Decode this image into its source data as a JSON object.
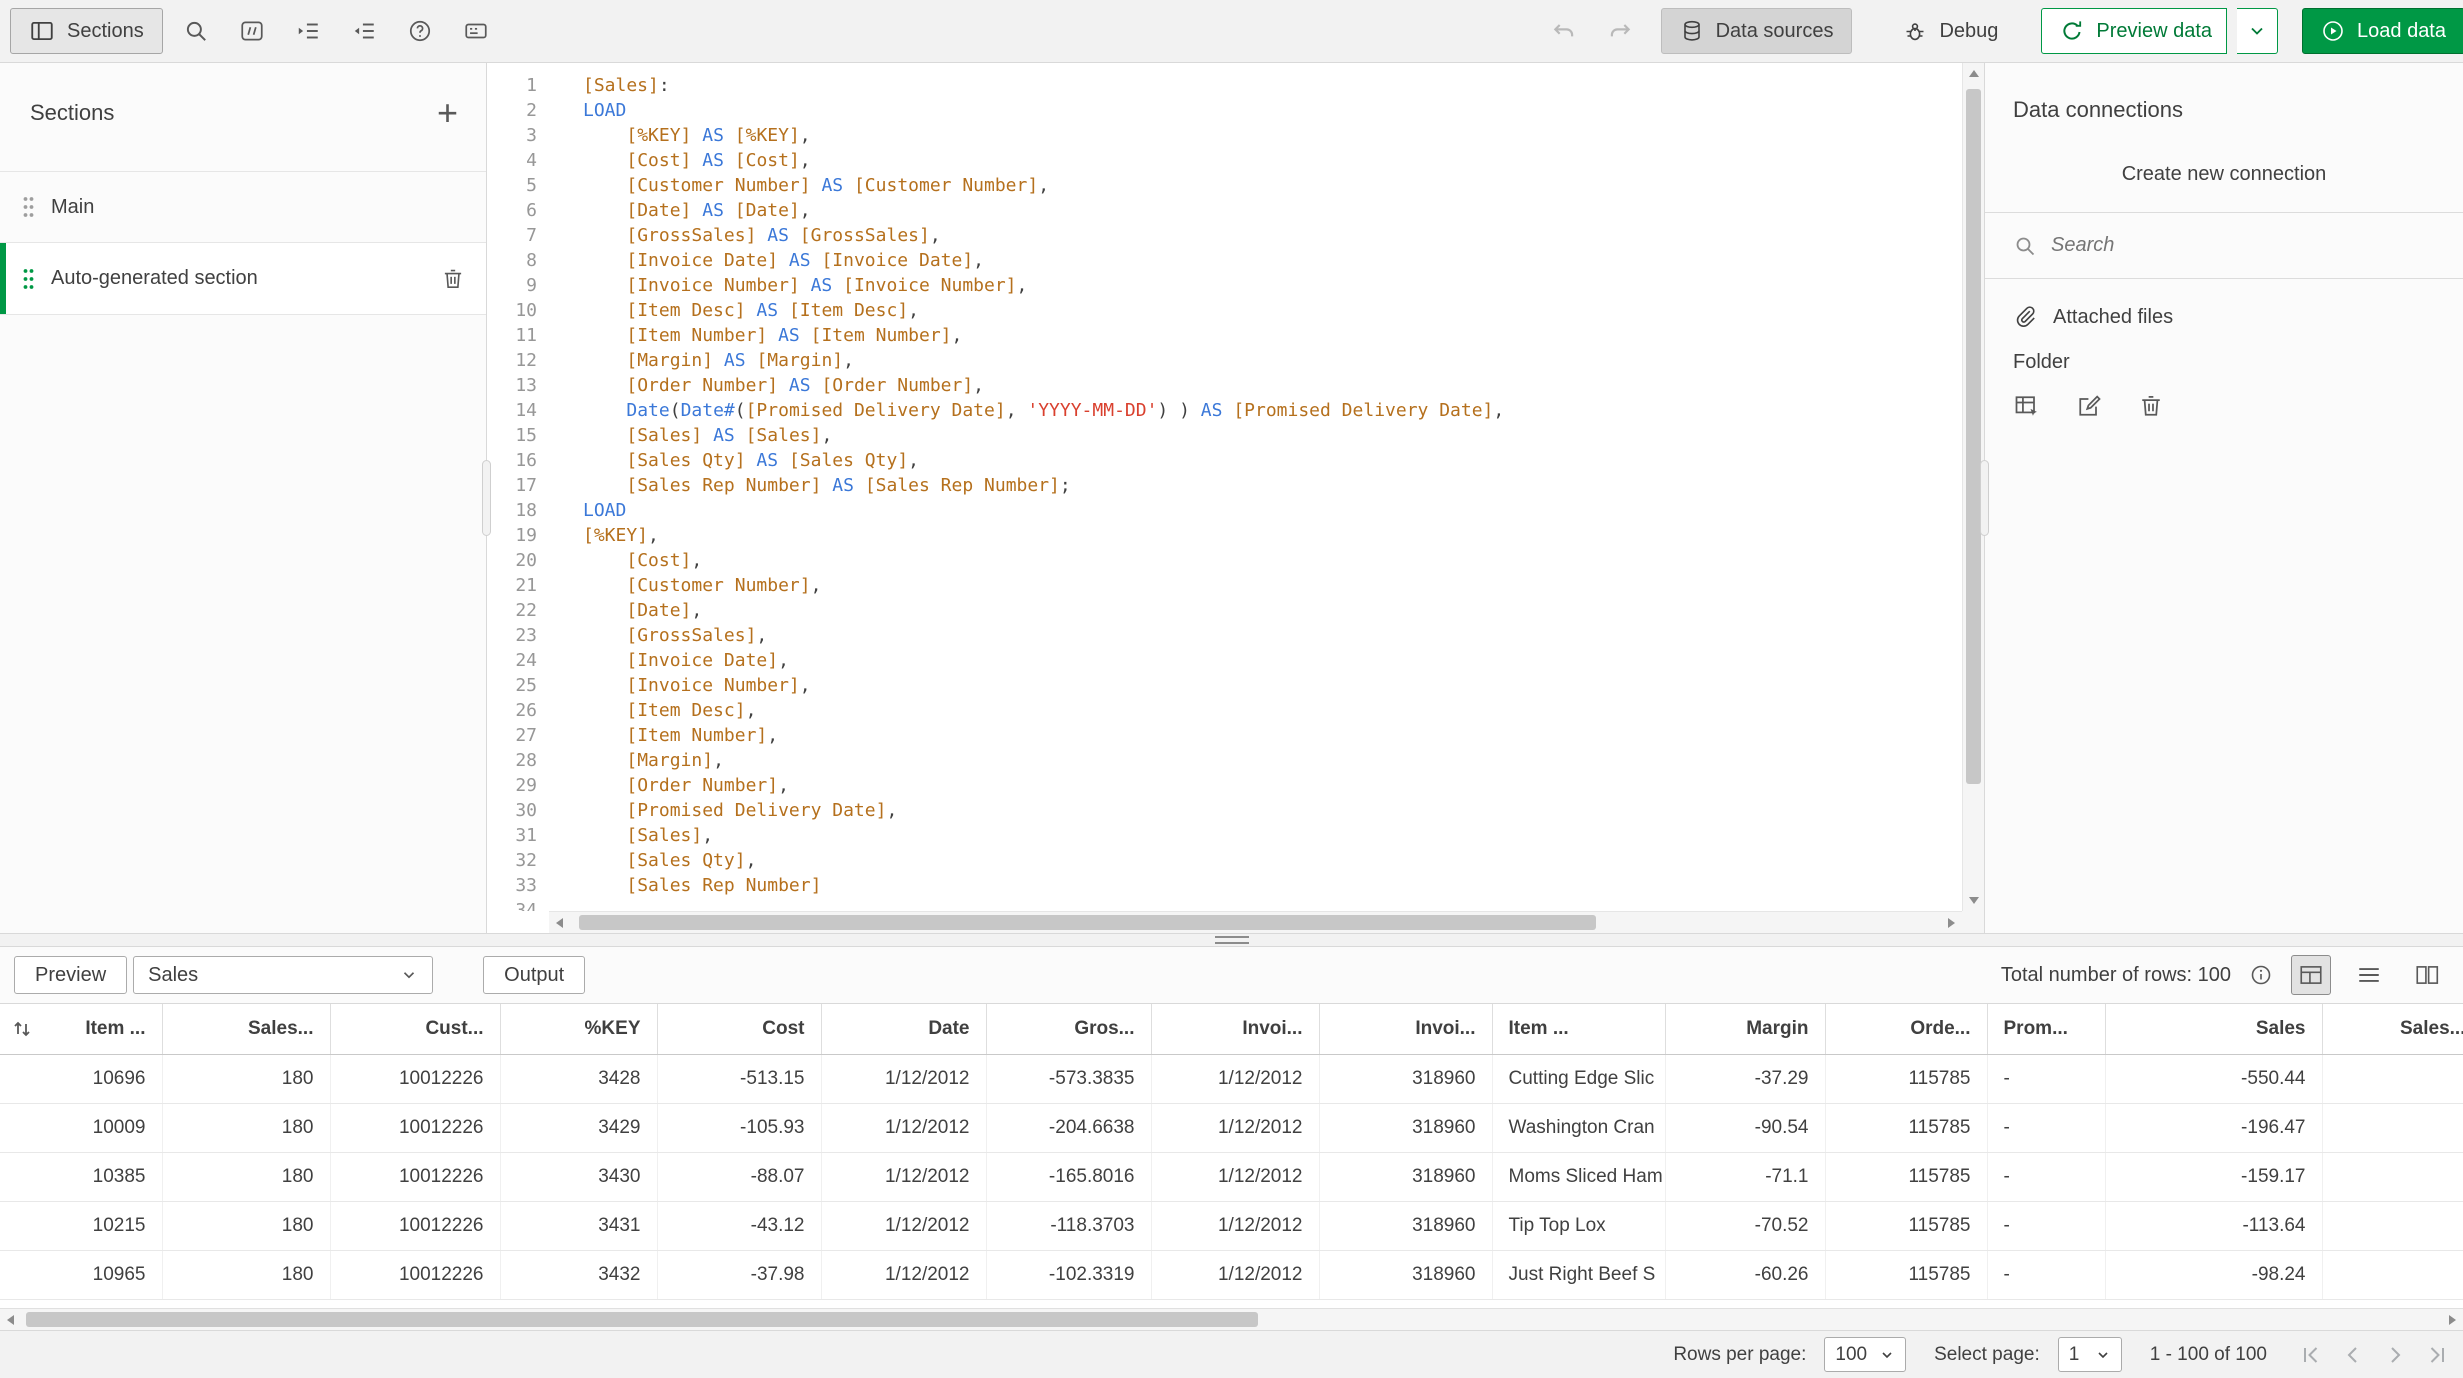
{
  "colors": {
    "accent_green": "#009845",
    "keyword": "#3b78d8",
    "field": "#b5701d",
    "string": "#d9402e"
  },
  "toolbar": {
    "sections": "Sections",
    "data_sources": "Data sources",
    "debug": "Debug",
    "preview_data": "Preview data",
    "load_data": "Load data"
  },
  "sidebar": {
    "title": "Sections",
    "items": [
      {
        "label": "Main",
        "selected": false
      },
      {
        "label": "Auto-generated section",
        "selected": true
      }
    ]
  },
  "editor": {
    "lines": [
      "[Sales]:",
      "LOAD",
      "    [%KEY] AS [%KEY],",
      "    [Cost] AS [Cost],",
      "    [Customer Number] AS [Customer Number],",
      "    [Date] AS [Date],",
      "    [GrossSales] AS [GrossSales],",
      "    [Invoice Date] AS [Invoice Date],",
      "    [Invoice Number] AS [Invoice Number],",
      "    [Item Desc] AS [Item Desc],",
      "    [Item Number] AS [Item Number],",
      "    [Margin] AS [Margin],",
      "    [Order Number] AS [Order Number],",
      "    Date(Date#([Promised Delivery Date], 'YYYY-MM-DD') ) AS [Promised Delivery Date],",
      "    [Sales] AS [Sales],",
      "    [Sales Qty] AS [Sales Qty],",
      "    [Sales Rep Number] AS [Sales Rep Number];",
      "LOAD",
      "[%KEY],",
      "    [Cost],",
      "    [Customer Number],",
      "    [Date],",
      "    [GrossSales],",
      "    [Invoice Date],",
      "    [Invoice Number],",
      "    [Item Desc],",
      "    [Item Number],",
      "    [Margin],",
      "    [Order Number],",
      "    [Promised Delivery Date],",
      "    [Sales],",
      "    [Sales Qty],",
      "    [Sales Rep Number]",
      ""
    ]
  },
  "connections": {
    "title": "Data connections",
    "create_button": "Create new connection",
    "search_placeholder": "Search",
    "attached_files": "Attached files",
    "folder": "Folder"
  },
  "preview": {
    "preview_button": "Preview",
    "table_selector_value": "Sales",
    "output_button": "Output",
    "total_rows": "Total number of rows: 100",
    "columns": [
      "Item ...",
      "Sales...",
      "Cust...",
      "%KEY",
      "Cost",
      "Date",
      "Gros...",
      "Invoi...",
      "Invoi...",
      "Item ...",
      "Margin",
      "Orde...",
      "Prom...",
      "Sales",
      "Sales..."
    ],
    "rows": [
      [
        "10696",
        "180",
        "10012226",
        "3428",
        "-513.15",
        "1/12/2012",
        "-573.3835",
        "1/12/2012",
        "318960",
        "Cutting Edge Slic",
        "-37.29",
        "115785",
        "-",
        "-550.44",
        ""
      ],
      [
        "10009",
        "180",
        "10012226",
        "3429",
        "-105.93",
        "1/12/2012",
        "-204.6638",
        "1/12/2012",
        "318960",
        "Washington Cran",
        "-90.54",
        "115785",
        "-",
        "-196.47",
        ""
      ],
      [
        "10385",
        "180",
        "10012226",
        "3430",
        "-88.07",
        "1/12/2012",
        "-165.8016",
        "1/12/2012",
        "318960",
        "Moms Sliced Ham",
        "-71.1",
        "115785",
        "-",
        "-159.17",
        ""
      ],
      [
        "10215",
        "180",
        "10012226",
        "3431",
        "-43.12",
        "1/12/2012",
        "-118.3703",
        "1/12/2012",
        "318960",
        "Tip Top Lox",
        "-70.52",
        "115785",
        "-",
        "-113.64",
        ""
      ],
      [
        "10965",
        "180",
        "10012226",
        "3432",
        "-37.98",
        "1/12/2012",
        "-102.3319",
        "1/12/2012",
        "318960",
        "Just Right Beef S",
        "-60.26",
        "115785",
        "-",
        "-98.24",
        ""
      ]
    ]
  },
  "pagination": {
    "rows_per_page_label": "Rows per page:",
    "rows_per_page_value": "100",
    "select_page_label": "Select page:",
    "select_page_value": "1",
    "range": "1 - 100 of 100"
  }
}
